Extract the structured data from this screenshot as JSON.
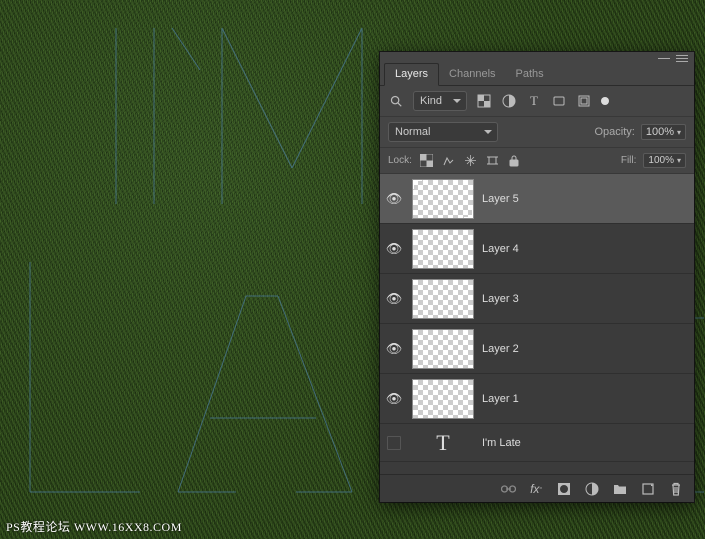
{
  "tabs": {
    "layers": "Layers",
    "channels": "Channels",
    "paths": "Paths"
  },
  "filter": {
    "kind": "Kind"
  },
  "blend": {
    "mode": "Normal",
    "opacity_label": "Opacity:",
    "opacity_val": "100%"
  },
  "lock": {
    "label": "Lock:",
    "fill_label": "Fill:",
    "fill_val": "100%"
  },
  "layers": [
    {
      "name": "Layer 5",
      "visible": true,
      "selected": true
    },
    {
      "name": "Layer 4",
      "visible": true,
      "selected": false
    },
    {
      "name": "Layer 3",
      "visible": true,
      "selected": false
    },
    {
      "name": "Layer 2",
      "visible": true,
      "selected": false
    },
    {
      "name": "Layer 1",
      "visible": true,
      "selected": false
    }
  ],
  "text_layer": {
    "name": "I'm Late",
    "visible": false
  },
  "watermark": "PS教程论坛 WWW.16XX8.COM"
}
